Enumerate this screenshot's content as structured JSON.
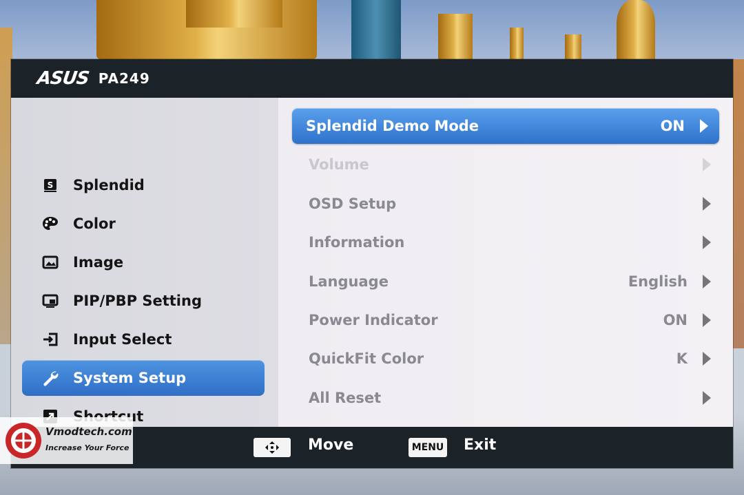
{
  "header": {
    "brand": "ASUS",
    "model": "PA249"
  },
  "menu": {
    "items": [
      {
        "label": "Splendid",
        "icon": "splendid-icon",
        "active": false
      },
      {
        "label": "Color",
        "icon": "palette-icon",
        "active": false
      },
      {
        "label": "Image",
        "icon": "image-icon",
        "active": false
      },
      {
        "label": "PIP/PBP Setting",
        "icon": "pip-icon",
        "active": false
      },
      {
        "label": "Input Select",
        "icon": "input-icon",
        "active": false
      },
      {
        "label": "System Setup",
        "icon": "wrench-icon",
        "active": true
      },
      {
        "label": "Shortcut",
        "icon": "shortcut-icon",
        "active": false
      }
    ]
  },
  "submenu": {
    "items": [
      {
        "label": "Splendid Demo Mode",
        "value": "ON",
        "state": "selected"
      },
      {
        "label": "Volume",
        "value": "",
        "state": "disabled"
      },
      {
        "label": "OSD Setup",
        "value": "",
        "state": "normal"
      },
      {
        "label": "Information",
        "value": "",
        "state": "normal"
      },
      {
        "label": "Language",
        "value": "English",
        "state": "normal"
      },
      {
        "label": "Power Indicator",
        "value": "ON",
        "state": "normal"
      },
      {
        "label": "QuickFit Color",
        "value": "K",
        "state": "normal"
      },
      {
        "label": "All Reset",
        "value": "",
        "state": "normal"
      }
    ]
  },
  "footer": {
    "move_label": "Move",
    "menu_key": "MENU",
    "exit_label": "Exit"
  },
  "watermark": {
    "title": "Vmodtech.com",
    "subtitle": "Increase Your Force"
  },
  "colors": {
    "accent": "#3a7fd5",
    "bar": "#1c2328",
    "panel": "#e6e3ea"
  }
}
